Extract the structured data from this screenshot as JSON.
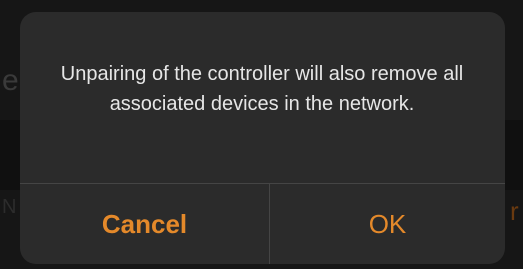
{
  "alert": {
    "message": "Unpairing of the controller will also remove all associated devices in the network.",
    "cancel_label": "Cancel",
    "ok_label": "OK",
    "accent_color": "#e4892a"
  }
}
